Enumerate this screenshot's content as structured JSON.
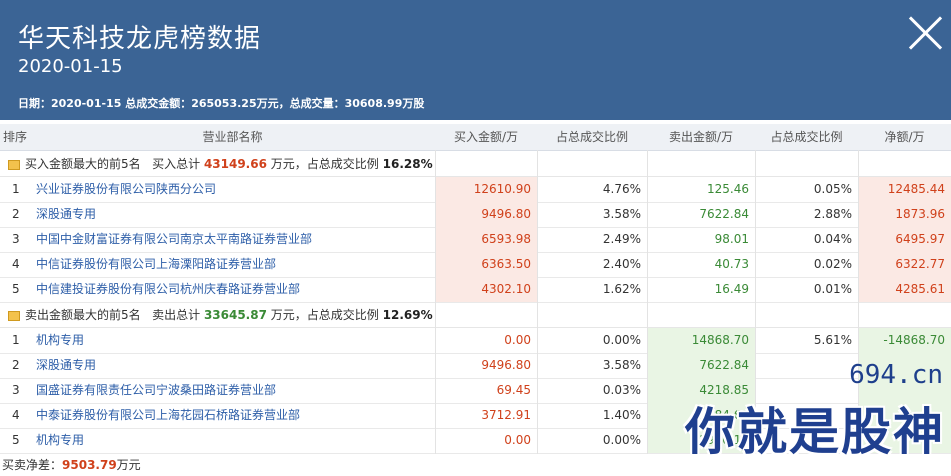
{
  "header": {
    "title": "华天科技龙虎榜数据",
    "date": "2020-01-15",
    "summary": "日期：2020-01-15 总成交金额：265053.25万元，总成交量：30608.99万股"
  },
  "table": {
    "columns": [
      "排序",
      "营业部名称",
      "买入金额/万",
      "占总成交比例",
      "卖出金额/万",
      "占总成交比例",
      "净额/万"
    ]
  },
  "buy_section": {
    "label": "买入金额最大的前5名",
    "total_label": "买入总计",
    "total": "43149.66",
    "unit_text": "万元，占总成交比例",
    "pct": "16.28%",
    "rows": [
      {
        "idx": "1",
        "name": "兴业证券股份有限公司陕西分公司",
        "buy": "12610.90",
        "buy_pct": "4.76%",
        "sell": "125.46",
        "sell_pct": "0.05%",
        "net": "12485.44"
      },
      {
        "idx": "2",
        "name": "深股通专用",
        "buy": "9496.80",
        "buy_pct": "3.58%",
        "sell": "7622.84",
        "sell_pct": "2.88%",
        "net": "1873.96"
      },
      {
        "idx": "3",
        "name": "中国中金财富证券有限公司南京太平南路证券营业部",
        "buy": "6593.98",
        "buy_pct": "2.49%",
        "sell": "98.01",
        "sell_pct": "0.04%",
        "net": "6495.97"
      },
      {
        "idx": "4",
        "name": "中信证券股份有限公司上海溧阳路证券营业部",
        "buy": "6363.50",
        "buy_pct": "2.40%",
        "sell": "40.73",
        "sell_pct": "0.02%",
        "net": "6322.77"
      },
      {
        "idx": "5",
        "name": "中信建投证券股份有限公司杭州庆春路证券营业部",
        "buy": "4302.10",
        "buy_pct": "1.62%",
        "sell": "16.49",
        "sell_pct": "0.01%",
        "net": "4285.61"
      }
    ]
  },
  "sell_section": {
    "label": "卖出金额最大的前5名",
    "total_label": "卖出总计",
    "total": "33645.87",
    "unit_text": "万元，占总成交比例",
    "pct": "12.69%",
    "rows": [
      {
        "idx": "1",
        "name": "机构专用",
        "buy": "0.00",
        "buy_pct": "0.00%",
        "sell": "14868.70",
        "sell_pct": "5.61%",
        "net": "-14868.70"
      },
      {
        "idx": "2",
        "name": "深股通专用",
        "buy": "9496.80",
        "buy_pct": "3.58%",
        "sell": "7622.84",
        "sell_pct": "",
        "net": ""
      },
      {
        "idx": "3",
        "name": "国盛证券有限责任公司宁波桑田路证券营业部",
        "buy": "69.45",
        "buy_pct": "0.03%",
        "sell": "4218.85",
        "sell_pct": "",
        "net": ""
      },
      {
        "idx": "4",
        "name": "中泰证券股份有限公司上海花园石桥路证券营业部",
        "buy": "3712.91",
        "buy_pct": "1.40%",
        "sell": "3684.61",
        "sell_pct": "",
        "net": ""
      },
      {
        "idx": "5",
        "name": "机构专用",
        "buy": "0.00",
        "buy_pct": "0.00%",
        "sell": "2970.16",
        "sell_pct": "",
        "net": ""
      }
    ]
  },
  "footer": {
    "label": "买卖净差：",
    "value": "9503.79",
    "unit": "万元"
  },
  "watermark": {
    "domain": "694.cn",
    "slogan": "你就是股神"
  },
  "colors": {
    "header_bg": "#3b6495",
    "buy_red": "#d0411b",
    "sell_green": "#3a8a36",
    "link_blue": "#2d5ea8"
  }
}
